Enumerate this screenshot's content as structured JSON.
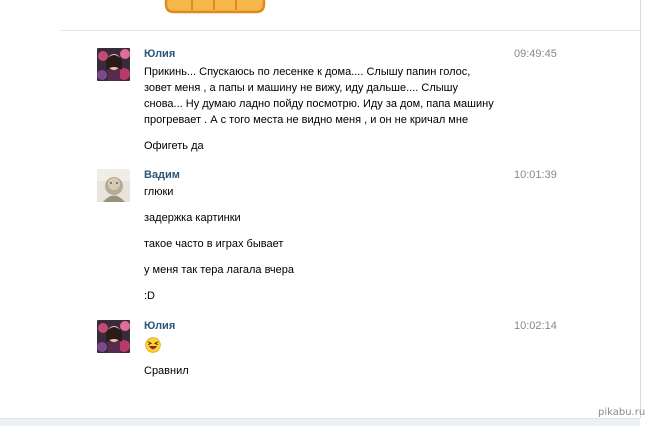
{
  "messages": [
    {
      "author": "Юлия",
      "time": "09:49:45",
      "avatar": "julia-avatar",
      "lines": [
        "Прикинь... Спускаюсь по лесенке к дома.... Слышу папин голос,",
        "зовет меня , а папы и машину не вижу, иду дальше.... Слышу",
        "снова... Ну думаю ладно пойду посмотрю. Иду за дом, папа машину",
        "прогревает . А с того места не видно меня , и он не кричал мне"
      ],
      "followups": [
        "Офигеть да"
      ]
    },
    {
      "author": "Вадим",
      "time": "10:01:39",
      "avatar": "vadim-avatar",
      "lines": [
        "глюки"
      ],
      "followups": [
        "задержка картинки",
        "такое часто в играх бывает",
        "у меня так тера лагала вчера",
        ":D"
      ]
    },
    {
      "author": "Юлия",
      "time": "10:02:14",
      "avatar": "julia-avatar",
      "emoji": "laughing-emoji",
      "followups": [
        "Сравнил"
      ]
    }
  ],
  "watermark": "pikabu.ru",
  "colors": {
    "author": "#2b587a",
    "time": "#888888",
    "divider": "#e4e9ef",
    "sticker": "#f6b74a"
  }
}
